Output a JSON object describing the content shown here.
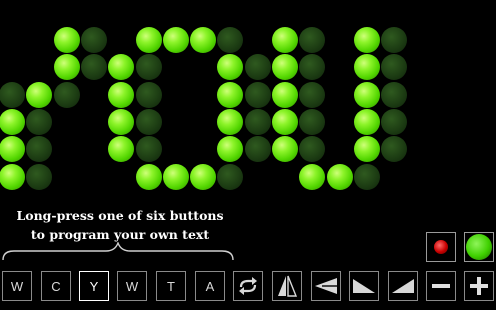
{
  "hint": {
    "line1": "Long-press one of six buttons",
    "line2": "to program your own text"
  },
  "text_buttons": [
    {
      "label": "W",
      "selected": false
    },
    {
      "label": "C",
      "selected": false
    },
    {
      "label": "Y",
      "selected": true
    },
    {
      "label": "W",
      "selected": false
    },
    {
      "label": "T",
      "selected": false
    },
    {
      "label": "A",
      "selected": false
    }
  ],
  "tool_buttons": [
    {
      "name": "repeat-button",
      "icon": "repeat-icon"
    },
    {
      "name": "mirror-button",
      "icon": "flip-horizontal-icon"
    },
    {
      "name": "perspective-button",
      "icon": "perspective-icon"
    },
    {
      "name": "slope-down-button",
      "icon": "slope-down-icon"
    },
    {
      "name": "slope-up-button",
      "icon": "slope-up-icon"
    },
    {
      "name": "zoom-out-button",
      "icon": "minus-icon"
    },
    {
      "name": "zoom-in-button",
      "icon": "plus-icon"
    }
  ],
  "color_indicators": [
    {
      "name": "red-led",
      "color": "#c80000"
    },
    {
      "name": "green-led",
      "color": "#3fd000"
    }
  ],
  "colors": {
    "led_on": "#52d600",
    "led_off": "#1b3a12"
  }
}
